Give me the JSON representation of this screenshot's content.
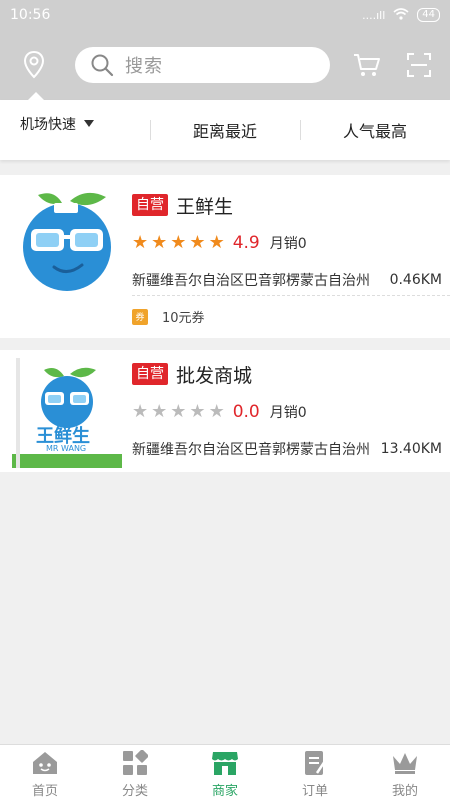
{
  "status_bar": {
    "time": "10:56",
    "network": "....ıll",
    "battery": "44"
  },
  "search": {
    "placeholder": "搜索"
  },
  "filters": {
    "airport": "机场快速",
    "distance": "距离最近",
    "popular": "人气最高"
  },
  "stores": [
    {
      "tag": "自营",
      "name": "王鲜生",
      "rating": 4.9,
      "rating_text": "4.9",
      "stars_on": 5,
      "sales": "月销0",
      "address": "新疆维吾尔自治区巴音郭楞蒙古自治州",
      "distance": "0.46KM",
      "coupon_icon": "券",
      "coupon": "10元券"
    },
    {
      "tag": "自营",
      "name": "批发商城",
      "rating": 0.0,
      "rating_text": "0.0",
      "stars_on": 0,
      "sales": "月销0",
      "address": "新疆维吾尔自治区巴音郭楞蒙古自治州",
      "distance": "13.40KM"
    }
  ],
  "logo2_text": {
    "cn": "王鲜生",
    "en": "MR WANG"
  },
  "tabs": [
    {
      "label": "首页",
      "icon": "home-icon",
      "active": false
    },
    {
      "label": "分类",
      "icon": "category-icon",
      "active": false
    },
    {
      "label": "商家",
      "icon": "store-icon",
      "active": true
    },
    {
      "label": "订单",
      "icon": "order-icon",
      "active": false
    },
    {
      "label": "我的",
      "icon": "crown-icon",
      "active": false
    }
  ],
  "colors": {
    "accent": "#2aa564",
    "tag_red": "#e0262b",
    "star_orange": "#f08a1c",
    "coupon_orange": "#f0a32b"
  }
}
